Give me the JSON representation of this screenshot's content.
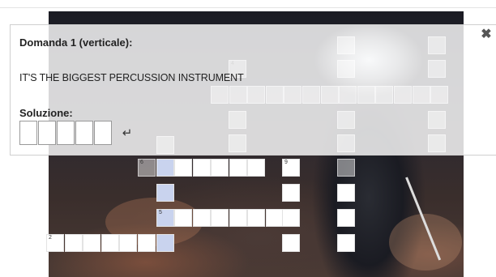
{
  "question": {
    "title": "Domanda 1 (verticale):",
    "text": "IT'S THE BIGGEST PERCUSSION INSTRUMENT",
    "solution_label": "Soluzione:",
    "answer_length": 5
  },
  "icons": {
    "close": "close-icon",
    "enter": "enter-return-icon"
  },
  "clue_numbers": {
    "n4": "4",
    "n6": "6",
    "n9": "9",
    "n5": "5",
    "n2": "2"
  },
  "colors": {
    "highlight_cell": "#c9d3ee",
    "panel_bg": "#ffffff"
  }
}
